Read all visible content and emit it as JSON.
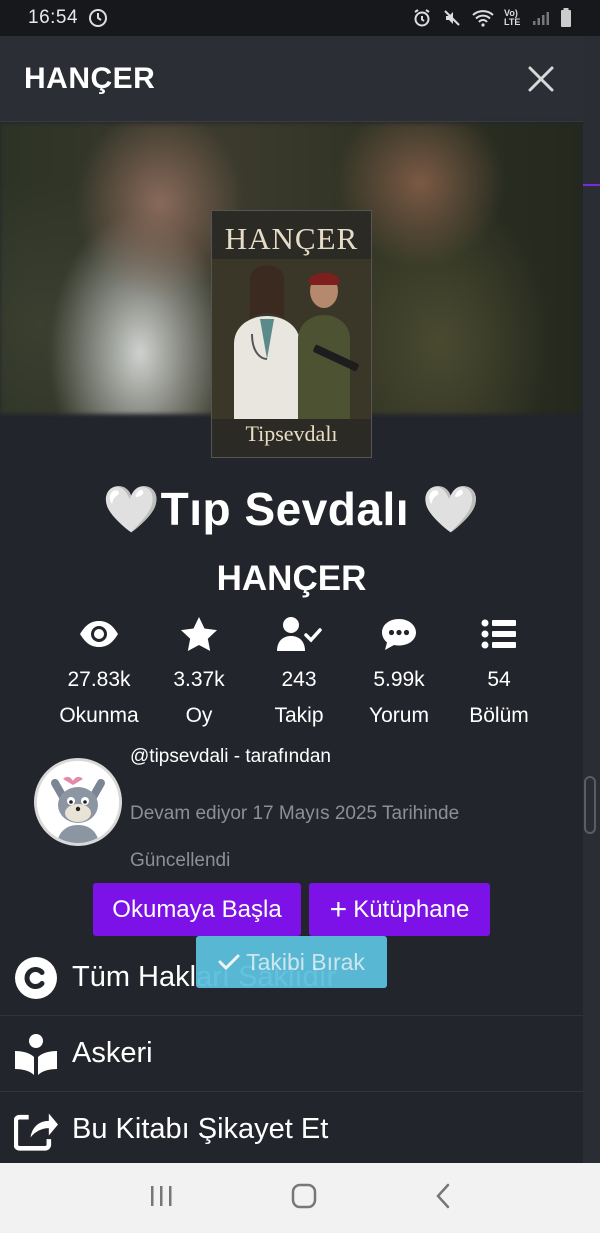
{
  "status_bar": {
    "time": "16:54",
    "network_label": "Vo) LTE"
  },
  "header": {
    "title": "HANÇER",
    "close_icon": "close-icon"
  },
  "cover": {
    "title": "HANÇER",
    "author": "Tipsevdalı"
  },
  "book": {
    "author_display": "🤍Tıp Sevdalı 🤍",
    "title": "HANÇER"
  },
  "stats": [
    {
      "icon": "eye-icon",
      "value": "27.83k",
      "label": "Okunma"
    },
    {
      "icon": "star-icon",
      "value": "3.37k",
      "label": "Oy"
    },
    {
      "icon": "user-check-icon",
      "value": "243",
      "label": "Takip"
    },
    {
      "icon": "comment-icon",
      "value": "5.99k",
      "label": "Yorum"
    },
    {
      "icon": "list-icon",
      "value": "54",
      "label": "Bölüm"
    }
  ],
  "author": {
    "handle": "@tipsevdali - tarafından",
    "status": "Devam ediyor 17 Mayıs 2025 Tarihinde Güncellendi"
  },
  "buttons": {
    "read": "Okumaya Başla",
    "library": "Kütüphane",
    "unfollow": "Takibi Bırak"
  },
  "rows": [
    {
      "icon": "copyright-icon",
      "label": "Tüm Hakları Saklıdır"
    },
    {
      "icon": "book-reader-icon",
      "label": "Askeri"
    },
    {
      "icon": "share-report-icon",
      "label": "Bu Kitabı Şikayet Et"
    }
  ],
  "colors": {
    "primary_button": "#7d12e8",
    "info_button": "#5bc0de",
    "panel_bg": "#23252c"
  }
}
